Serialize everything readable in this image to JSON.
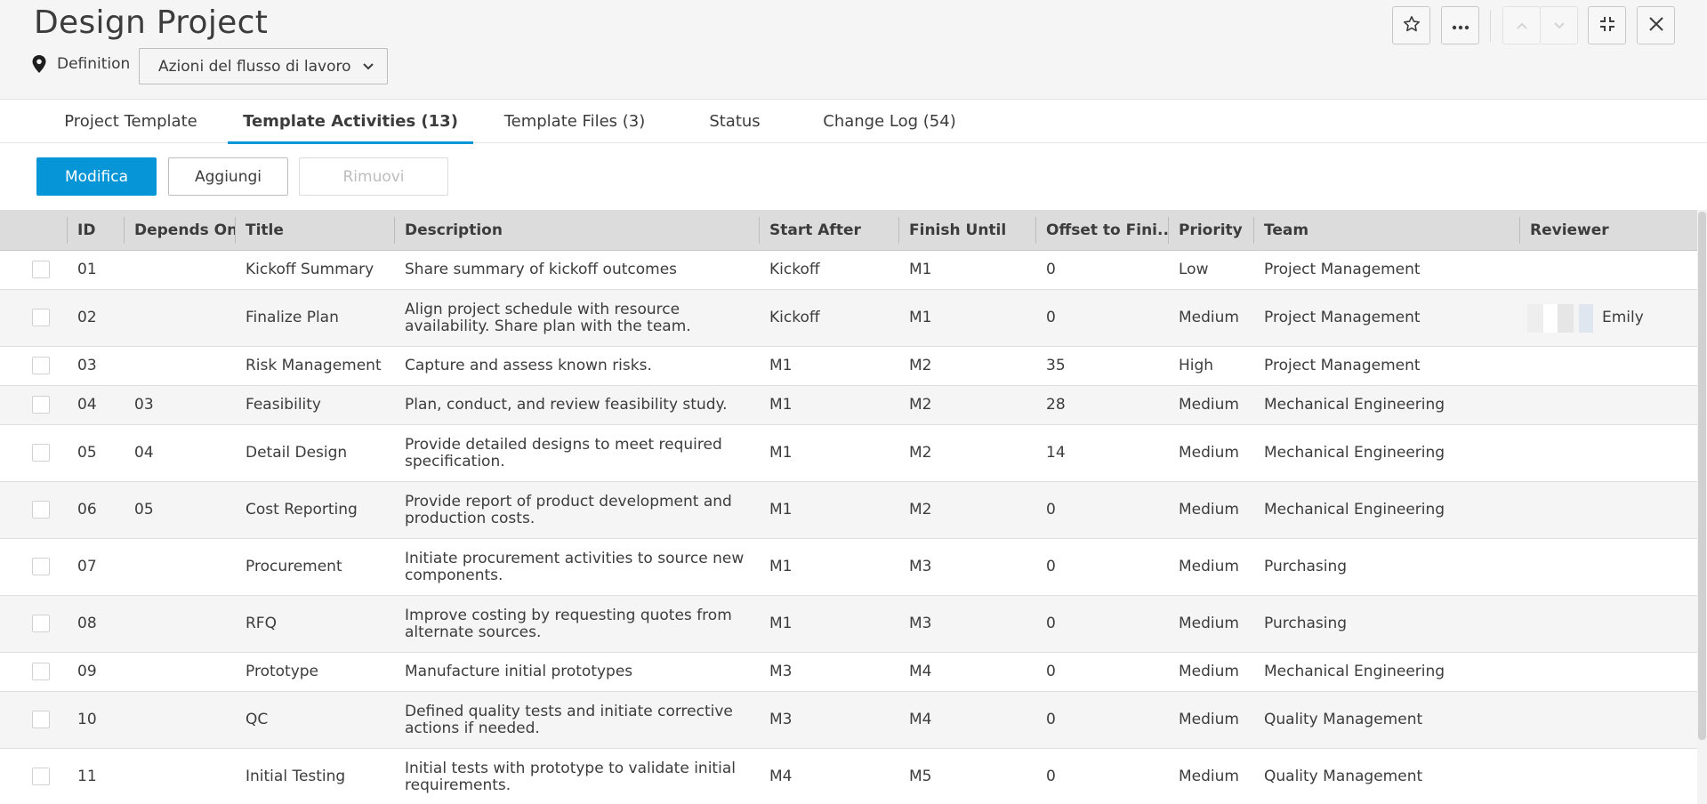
{
  "header": {
    "title": "Design Project",
    "location_label": "Definition",
    "workflow_button_label": "Azioni del flusso di lavoro",
    "buttons": [
      {
        "icon": "star-icon"
      },
      {
        "icon": "more-icon"
      },
      {
        "icon": "chevron-up-icon"
      },
      {
        "icon": "chevron-down-icon"
      },
      {
        "icon": "minimize-icon"
      },
      {
        "icon": "close-icon"
      }
    ]
  },
  "tabs": [
    {
      "label": "Project Template",
      "active": false
    },
    {
      "label": "Template Activities (13)",
      "active": true
    },
    {
      "label": "Template Files (3)",
      "active": false
    },
    {
      "label": "Status",
      "active": false
    },
    {
      "label": "Change Log (54)",
      "active": false
    }
  ],
  "toolbar": {
    "edit_label": "Modifica",
    "add_label": "Aggiungi",
    "remove_label": "Rimuovi"
  },
  "table": {
    "columns": [
      "ID",
      "Depends On",
      "Title",
      "Description",
      "Start After",
      "Finish Until",
      "Offset to Fini...",
      "Priority",
      "Team",
      "Reviewer"
    ],
    "rows": [
      {
        "id": "01",
        "depends_on": "",
        "title": "Kickoff Summary",
        "description": "Share summary of kickoff outcomes",
        "start_after": "Kickoff",
        "finish_until": "M1",
        "offset": "0",
        "priority": "Low",
        "team": "Project Management",
        "reviewer": ""
      },
      {
        "id": "02",
        "depends_on": "",
        "title": "Finalize Plan",
        "description": "Align project schedule with resource availability. Share plan with the team.",
        "start_after": "Kickoff",
        "finish_until": "M1",
        "offset": "0",
        "priority": "Medium",
        "team": "Project Management",
        "reviewer": "Emily"
      },
      {
        "id": "03",
        "depends_on": "",
        "title": "Risk Management",
        "description": "Capture and assess known risks.",
        "start_after": "M1",
        "finish_until": "M2",
        "offset": "35",
        "priority": "High",
        "team": "Project Management",
        "reviewer": ""
      },
      {
        "id": "04",
        "depends_on": "03",
        "title": "Feasibility",
        "description": "Plan, conduct, and review feasibility study.",
        "start_after": "M1",
        "finish_until": "M2",
        "offset": "28",
        "priority": "Medium",
        "team": "Mechanical Engineering",
        "reviewer": ""
      },
      {
        "id": "05",
        "depends_on": "04",
        "title": "Detail Design",
        "description": "Provide detailed designs to meet required specification.",
        "start_after": "M1",
        "finish_until": "M2",
        "offset": "14",
        "priority": "Medium",
        "team": "Mechanical Engineering",
        "reviewer": ""
      },
      {
        "id": "06",
        "depends_on": "05",
        "title": "Cost Reporting",
        "description": "Provide report of product development and production costs.",
        "start_after": "M1",
        "finish_until": "M2",
        "offset": "0",
        "priority": "Medium",
        "team": "Mechanical Engineering",
        "reviewer": ""
      },
      {
        "id": "07",
        "depends_on": "",
        "title": "Procurement",
        "description": "Initiate procurement activities to source new components.",
        "start_after": "M1",
        "finish_until": "M3",
        "offset": "0",
        "priority": "Medium",
        "team": "Purchasing",
        "reviewer": ""
      },
      {
        "id": "08",
        "depends_on": "",
        "title": "RFQ",
        "description": "Improve costing by requesting quotes from alternate sources.",
        "start_after": "M1",
        "finish_until": "M3",
        "offset": "0",
        "priority": "Medium",
        "team": "Purchasing",
        "reviewer": ""
      },
      {
        "id": "09",
        "depends_on": "",
        "title": "Prototype",
        "description": "Manufacture initial prototypes",
        "start_after": "M3",
        "finish_until": "M4",
        "offset": "0",
        "priority": "Medium",
        "team": "Mechanical Engineering",
        "reviewer": ""
      },
      {
        "id": "10",
        "depends_on": "",
        "title": "QC",
        "description": "Defined quality tests and initiate corrective actions if needed.",
        "start_after": "M3",
        "finish_until": "M4",
        "offset": "0",
        "priority": "Medium",
        "team": "Quality Management",
        "reviewer": ""
      },
      {
        "id": "11",
        "depends_on": "",
        "title": "Initial Testing",
        "description": "Initial tests with prototype to validate initial requirements.",
        "start_after": "M4",
        "finish_until": "M5",
        "offset": "0",
        "priority": "Medium",
        "team": "Quality Management",
        "reviewer": ""
      }
    ]
  },
  "colors": {
    "accent": "#0696d7",
    "header_bg": "#f5f5f5",
    "grid_header_bg": "#dcdcdc",
    "alt_row_bg": "#f5f5f5"
  }
}
